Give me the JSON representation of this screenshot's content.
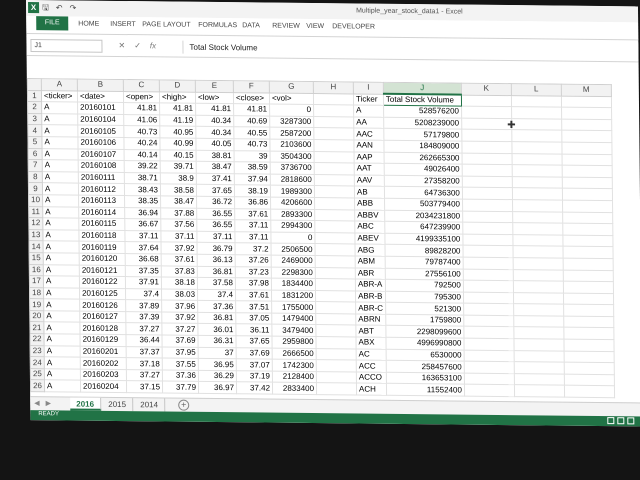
{
  "app": {
    "window_title": "Multiple_year_stock_data1 - Excel",
    "logo_letter": "X",
    "qat_icons": [
      "save-icon",
      "undo-icon",
      "redo-icon"
    ]
  },
  "ribbon": {
    "tabs": [
      "FILE",
      "HOME",
      "INSERT",
      "PAGE LAYOUT",
      "FORMULAS",
      "DATA",
      "REVIEW",
      "VIEW",
      "DEVELOPER"
    ]
  },
  "formula_bar": {
    "name_box": "J1",
    "content": "Total Stock Volume"
  },
  "grid": {
    "columns": [
      "A",
      "B",
      "C",
      "D",
      "E",
      "F",
      "G",
      "H",
      "I",
      "J",
      "K",
      "L",
      "M"
    ],
    "selected_column": "J",
    "rows": [
      [
        "<ticker>",
        "<date>",
        "<open>",
        "<high>",
        "<low>",
        "<close>",
        "<vol>",
        "",
        "Ticker",
        "Total Stock Volume",
        "",
        "",
        ""
      ],
      [
        "A",
        "20160101",
        "41.81",
        "41.81",
        "41.81",
        "41.81",
        "0",
        "",
        "A",
        "528576200",
        "",
        "",
        ""
      ],
      [
        "A",
        "20160104",
        "41.06",
        "41.19",
        "40.34",
        "40.69",
        "3287300",
        "",
        "AA",
        "5208239000",
        "",
        "",
        ""
      ],
      [
        "A",
        "20160105",
        "40.73",
        "40.95",
        "40.34",
        "40.55",
        "2587200",
        "",
        "AAC",
        "57179800",
        "",
        "",
        ""
      ],
      [
        "A",
        "20160106",
        "40.24",
        "40.99",
        "40.05",
        "40.73",
        "2103600",
        "",
        "AAN",
        "184809000",
        "",
        "",
        ""
      ],
      [
        "A",
        "20160107",
        "40.14",
        "40.15",
        "38.81",
        "39",
        "3504300",
        "",
        "AAP",
        "262665300",
        "",
        "",
        ""
      ],
      [
        "A",
        "20160108",
        "39.22",
        "39.71",
        "38.47",
        "38.59",
        "3736700",
        "",
        "AAT",
        "49026400",
        "",
        "",
        ""
      ],
      [
        "A",
        "20160111",
        "38.71",
        "38.9",
        "37.41",
        "37.94",
        "2818600",
        "",
        "AAV",
        "27358200",
        "",
        "",
        ""
      ],
      [
        "A",
        "20160112",
        "38.43",
        "38.58",
        "37.65",
        "38.19",
        "1989300",
        "",
        "AB",
        "64736300",
        "",
        "",
        ""
      ],
      [
        "A",
        "20160113",
        "38.35",
        "38.47",
        "36.72",
        "36.86",
        "4206600",
        "",
        "ABB",
        "503779400",
        "",
        "",
        ""
      ],
      [
        "A",
        "20160114",
        "36.94",
        "37.88",
        "36.55",
        "37.61",
        "2893300",
        "",
        "ABBV",
        "2034231800",
        "",
        "",
        ""
      ],
      [
        "A",
        "20160115",
        "36.67",
        "37.56",
        "36.55",
        "37.11",
        "2994300",
        "",
        "ABC",
        "647239900",
        "",
        "",
        ""
      ],
      [
        "A",
        "20160118",
        "37.11",
        "37.11",
        "37.11",
        "37.11",
        "0",
        "",
        "ABEV",
        "4199335100",
        "",
        "",
        ""
      ],
      [
        "A",
        "20160119",
        "37.64",
        "37.92",
        "36.79",
        "37.2",
        "2506500",
        "",
        "ABG",
        "89828200",
        "",
        "",
        ""
      ],
      [
        "A",
        "20160120",
        "36.68",
        "37.61",
        "36.13",
        "37.26",
        "2469000",
        "",
        "ABM",
        "79787400",
        "",
        "",
        ""
      ],
      [
        "A",
        "20160121",
        "37.35",
        "37.83",
        "36.81",
        "37.23",
        "2298300",
        "",
        "ABR",
        "27556100",
        "",
        "",
        ""
      ],
      [
        "A",
        "20160122",
        "37.91",
        "38.18",
        "37.58",
        "37.98",
        "1834400",
        "",
        "ABR-A",
        "792500",
        "",
        "",
        ""
      ],
      [
        "A",
        "20160125",
        "37.4",
        "38.03",
        "37.4",
        "37.61",
        "1831200",
        "",
        "ABR-B",
        "795300",
        "",
        "",
        ""
      ],
      [
        "A",
        "20160126",
        "37.89",
        "37.96",
        "37.36",
        "37.51",
        "1755000",
        "",
        "ABR-C",
        "521300",
        "",
        "",
        ""
      ],
      [
        "A",
        "20160127",
        "37.39",
        "37.92",
        "36.81",
        "37.05",
        "1479400",
        "",
        "ABRN",
        "1759800",
        "",
        "",
        ""
      ],
      [
        "A",
        "20160128",
        "37.27",
        "37.27",
        "36.01",
        "36.11",
        "3479400",
        "",
        "ABT",
        "2298099600",
        "",
        "",
        ""
      ],
      [
        "A",
        "20160129",
        "36.44",
        "37.69",
        "36.31",
        "37.65",
        "2959800",
        "",
        "ABX",
        "4996990800",
        "",
        "",
        ""
      ],
      [
        "A",
        "20160201",
        "37.37",
        "37.95",
        "37",
        "37.69",
        "2666500",
        "",
        "AC",
        "6530000",
        "",
        "",
        ""
      ],
      [
        "A",
        "20160202",
        "37.18",
        "37.55",
        "36.95",
        "37.07",
        "1742300",
        "",
        "ACC",
        "258457600",
        "",
        "",
        ""
      ],
      [
        "A",
        "20160203",
        "37.27",
        "37.36",
        "36.29",
        "37.19",
        "2128400",
        "",
        "ACCO",
        "163653100",
        "",
        "",
        ""
      ],
      [
        "A",
        "20160204",
        "37.15",
        "37.79",
        "36.97",
        "37.42",
        "2833400",
        "",
        "ACH",
        "11552400",
        "",
        "",
        ""
      ]
    ]
  },
  "sheets": {
    "tabs": [
      "2016",
      "2015",
      "2014"
    ],
    "active": "2016"
  },
  "status": {
    "text": "READY"
  }
}
